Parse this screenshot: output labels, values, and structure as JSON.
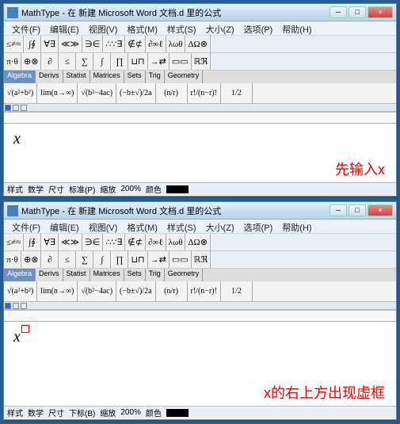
{
  "win1": {
    "title": "MathType - 在 新建 Microsoft Word 文档.d 里的公式",
    "menus": [
      "文件(F)",
      "编辑(E)",
      "视图(V)",
      "格式(M)",
      "样式(S)",
      "大小(Z)",
      "选项(P)",
      "帮助(H)"
    ],
    "equation": "x",
    "annotation": "先输入x",
    "status": {
      "style": "样式",
      "math": "数学",
      "size": "尺寸",
      "std": "标准(P)",
      "zoom": "缩放",
      "zoomval": "200%",
      "color": "颜色"
    }
  },
  "win2": {
    "title": "MathType - 在 新建 Microsoft Word 文档.d 里的公式",
    "menus": [
      "文件(F)",
      "编辑(E)",
      "视图(V)",
      "格式(M)",
      "样式(S)",
      "大小(Z)",
      "选项(P)",
      "帮助(H)"
    ],
    "equation": "x",
    "annotation": "x的右上方出现虚框",
    "status": {
      "style": "样式",
      "math": "数学",
      "size": "尺寸",
      "sub": "下标(B)",
      "zoom": "缩放",
      "zoomval": "200%",
      "color": "颜色"
    }
  },
  "tool": {
    "r1": [
      "≤≠≈",
      "∫∮",
      "∀∃",
      "≪≫",
      "∋∈",
      "∴∵∃",
      "∉⊄",
      "∂∞ℓ",
      "λωθ",
      "ΔΩ⊗"
    ],
    "r2": [
      "π·θ",
      "⊕⊗",
      "∂",
      "≤",
      "∑",
      "∫",
      "∏",
      "⊔⊓",
      "→⇄",
      "▭▭",
      "ℝℜ"
    ],
    "tabs": [
      "Algebra",
      "Derivs",
      "Statist",
      "Matrices",
      "Sets",
      "Trig",
      "Geometry"
    ],
    "tmpl": [
      "√(a²+b²)",
      "lim(n→∞)",
      "√(b²−4ac)",
      "(−b±√)/2a",
      "(n/r)",
      "r!/(n−r)!",
      "1/2"
    ]
  }
}
